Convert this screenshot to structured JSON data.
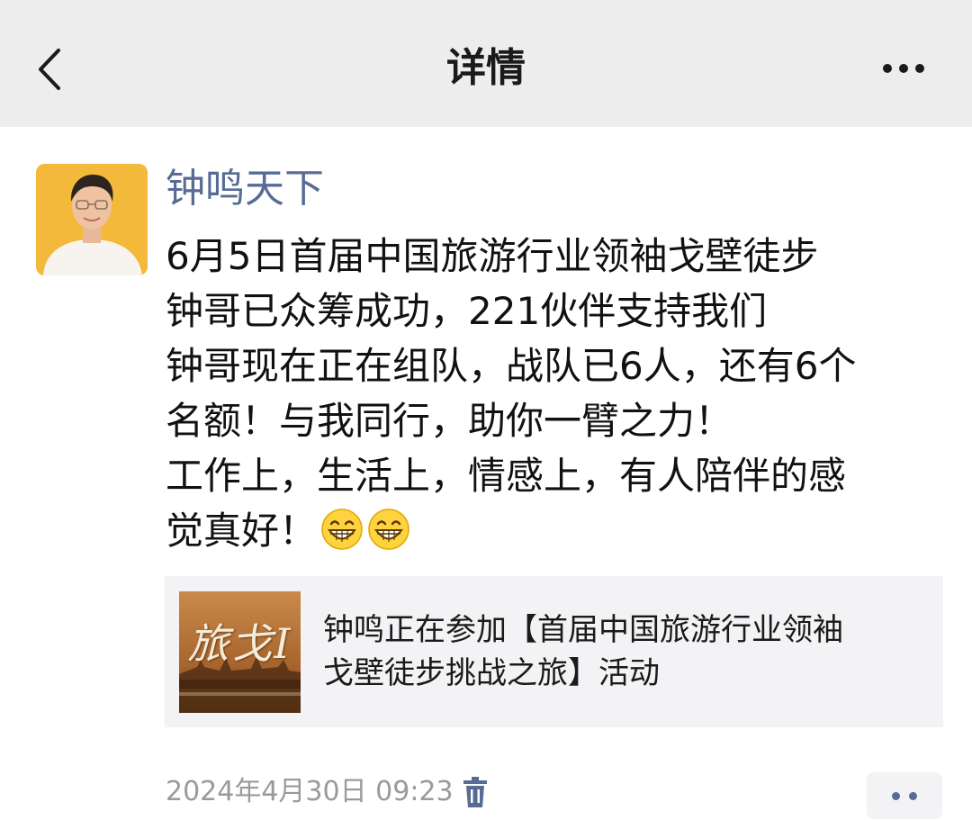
{
  "header": {
    "title": "详情",
    "back_icon": "chevron-left-icon",
    "more_icon": "more-horizontal-icon"
  },
  "post": {
    "author": "钟鸣天下",
    "lines": [
      "6月5日首届中国旅游行业领袖戈壁徒步",
      "钟哥已众筹成功，221伙伴支持我们",
      "钟哥现在正在组队，战队已6人，还有6个",
      "名额！与我同行，助你一臂之力！",
      "工作上，生活上，情感上，有人陪伴的感",
      "觉真好！"
    ],
    "emojis": [
      "grin-emoji",
      "grin-emoji"
    ]
  },
  "link_card": {
    "thumbnail_title": "旅戈I",
    "lines": [
      "钟鸣正在参加【首届中国旅游行业领袖",
      "戈壁徒步挑战之旅】活动"
    ]
  },
  "footer": {
    "timestamp": "2024年4月30日 09:23",
    "delete_icon": "trash-icon",
    "action_icon": "comment-more-icon"
  },
  "colors": {
    "topbar_bg": "#ededed",
    "name_color": "#576b95",
    "card_bg": "#f3f3f5",
    "meta_text": "#9a9a9a"
  }
}
